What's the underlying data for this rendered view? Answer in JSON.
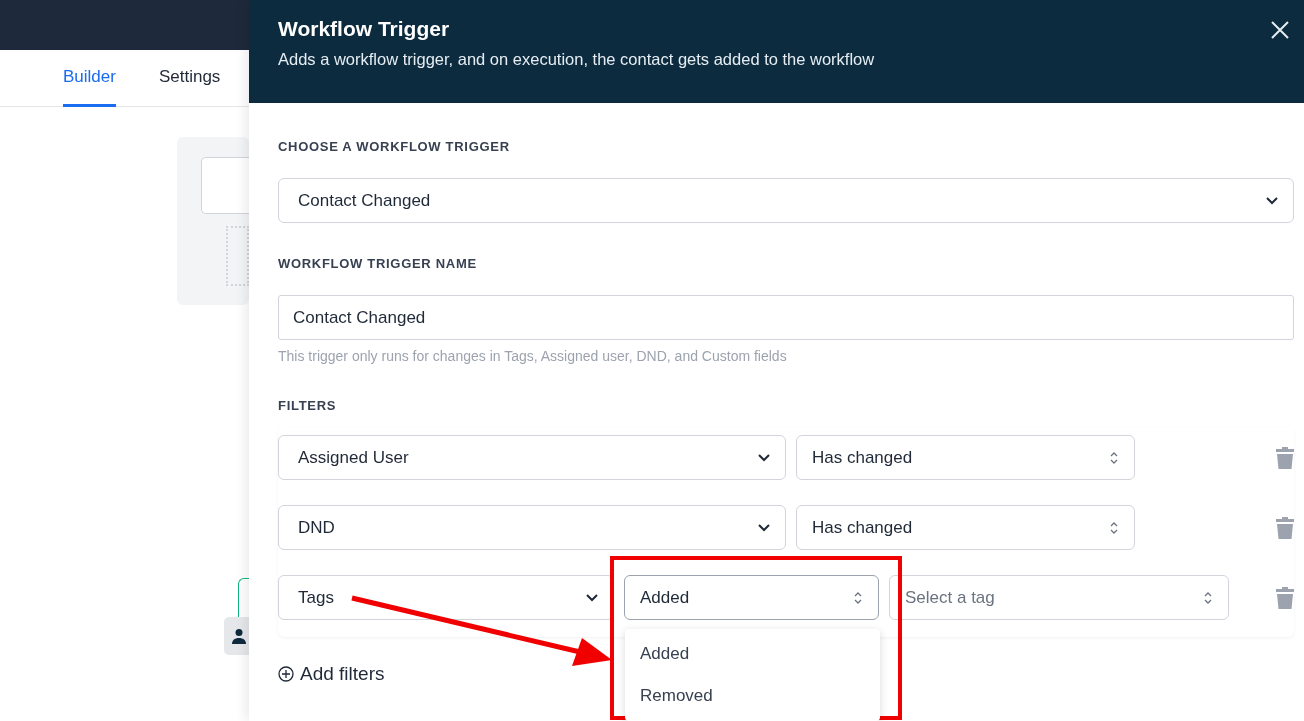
{
  "page_tabs": [
    {
      "label": "Builder",
      "selected": true
    },
    {
      "label": "Settings",
      "selected": false
    }
  ],
  "panel": {
    "title": "Workflow Trigger",
    "subtitle": "Adds a workflow trigger, and on execution, the contact gets added to the workflow",
    "trigger_label": "CHOOSE A WORKFLOW TRIGGER",
    "trigger_value": "Contact Changed",
    "name_label": "WORKFLOW TRIGGER NAME",
    "name_value": "Contact Changed",
    "name_hint": "This trigger only runs for changes in Tags, Assigned user, DND, and Custom fields",
    "filters_label": "FILTERS",
    "filters": [
      {
        "field": "Assigned User",
        "condition": "Has changed"
      },
      {
        "field": "DND",
        "condition": "Has changed"
      },
      {
        "field": "Tags",
        "condition": "Added",
        "value_placeholder": "Select a tag",
        "menu_open": true
      }
    ],
    "condition_menu": [
      {
        "label": "Added",
        "selected": false
      },
      {
        "label": "Removed",
        "selected": false
      }
    ],
    "add_filters": "Add filters"
  }
}
